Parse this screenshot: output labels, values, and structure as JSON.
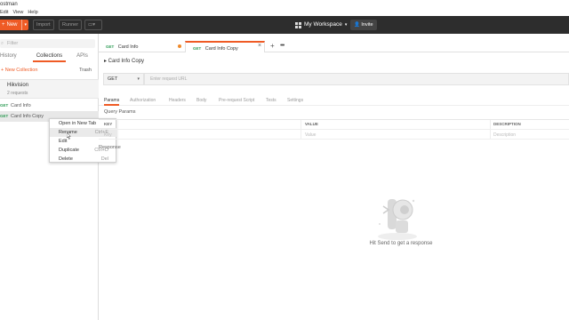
{
  "window": {
    "title": "ostman"
  },
  "menu": [
    "Edit",
    "View",
    "Help"
  ],
  "toolbar": {
    "new_label": "New",
    "import_label": "Import",
    "runner_label": "Runner",
    "workspace_label": "My Workspace",
    "invite_label": "Invite"
  },
  "sidebar": {
    "filter_placeholder": "Filter",
    "tabs": [
      "History",
      "Collections",
      "APIs"
    ],
    "active_tab": "Collections",
    "new_collection_label": "+ New Collection",
    "trash_label": "Trash",
    "collection": {
      "name": "Hikvision",
      "count": "2 requests"
    },
    "requests": [
      {
        "method": "GET",
        "name": "Card Info"
      },
      {
        "method": "GET",
        "name": "Card Info Copy"
      }
    ]
  },
  "context_menu": {
    "items": [
      {
        "label": "Open in New Tab",
        "shortcut": ""
      },
      {
        "label": "Rename",
        "shortcut": "Ctrl+E"
      },
      {
        "label": "Edit",
        "shortcut": ""
      },
      {
        "label": "Duplicate",
        "shortcut": "Ctrl+D"
      },
      {
        "label": "Delete",
        "shortcut": "Del"
      }
    ],
    "highlighted": "Rename"
  },
  "tabs": [
    {
      "method": "GET",
      "name": "Card Info"
    },
    {
      "method": "GET",
      "name": "Card Info Copy"
    }
  ],
  "request": {
    "breadcrumb": "▸ Card Info Copy",
    "method": "GET",
    "url_placeholder": "Enter request URL",
    "subtabs": [
      "Params",
      "Authorization",
      "Headers",
      "Body",
      "Pre-request Script",
      "Tests",
      "Settings"
    ],
    "active_subtab": "Params",
    "query_params_label": "Query Params",
    "columns": [
      "KEY",
      "VALUE",
      "DESCRIPTION"
    ],
    "row_placeholders": [
      "Key",
      "Value",
      "Description"
    ]
  },
  "response": {
    "label": "Response",
    "empty_text": "Hit Send to get a response"
  },
  "colors": {
    "accent": "#ef5b25",
    "toolbar": "#2d2d2d",
    "get": "#2e9b55"
  }
}
